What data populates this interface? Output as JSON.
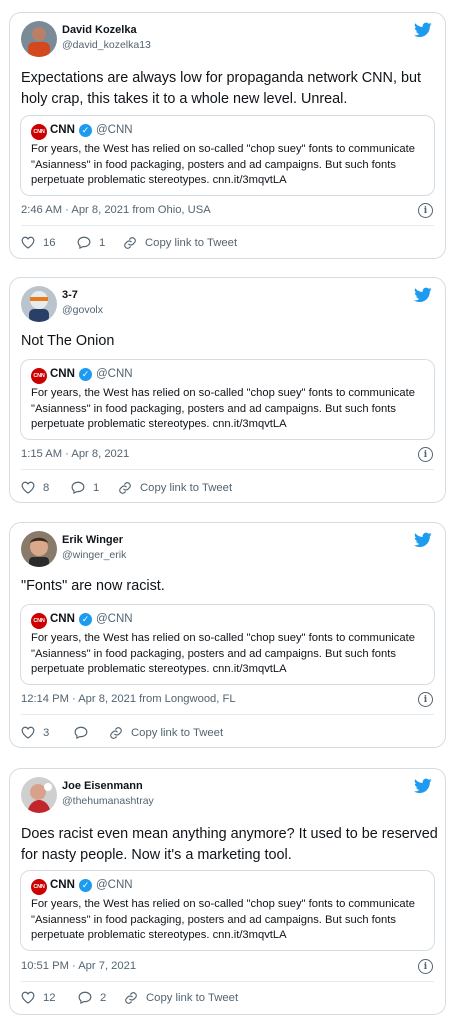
{
  "quoted": {
    "name": "CNN",
    "handle": "@CNN",
    "logo_text": "CNN",
    "text": "For years, the West has relied on so-called \"chop suey\" fonts to communicate \"Asianness\" in food packaging, posters and ad campaigns. But such fonts perpetuate problematic stereotypes. cnn.it/3mqvtLA"
  },
  "tweets": [
    {
      "name": "David Kozelka",
      "handle": "@david_kozelka13",
      "text": "Expectations are always low for propaganda network CNN, but holy crap, this takes it to a whole new level. Unreal.",
      "meta": "2:46 AM · Apr 8, 2021 from Ohio, USA",
      "likes": "16",
      "replies": "1",
      "copy_label": "Copy link to Tweet"
    },
    {
      "name": "3-7",
      "handle": "@govolx",
      "text": "Not The Onion",
      "meta": "1:15 AM · Apr 8, 2021",
      "likes": "8",
      "replies": "1",
      "copy_label": "Copy link to Tweet"
    },
    {
      "name": "Erik Winger",
      "handle": "@winger_erik",
      "text": "\"Fonts\" are now racist.",
      "meta": "12:14 PM · Apr 8, 2021 from Longwood, FL",
      "likes": "3",
      "replies": "",
      "copy_label": "Copy link to Tweet"
    },
    {
      "name": "Joe Eisenmann",
      "handle": "@thehumanashtray",
      "text": "Does racist even mean anything anymore? It used to be reserved for nasty people. Now it's a marketing tool.",
      "meta": "10:51 PM · Apr 7, 2021",
      "likes": "12",
      "replies": "2",
      "copy_label": "Copy link to Tweet"
    }
  ],
  "colors": {
    "twitter_blue": "#1d9bf0",
    "cnn_red": "#cc0000",
    "muted": "#536471"
  }
}
